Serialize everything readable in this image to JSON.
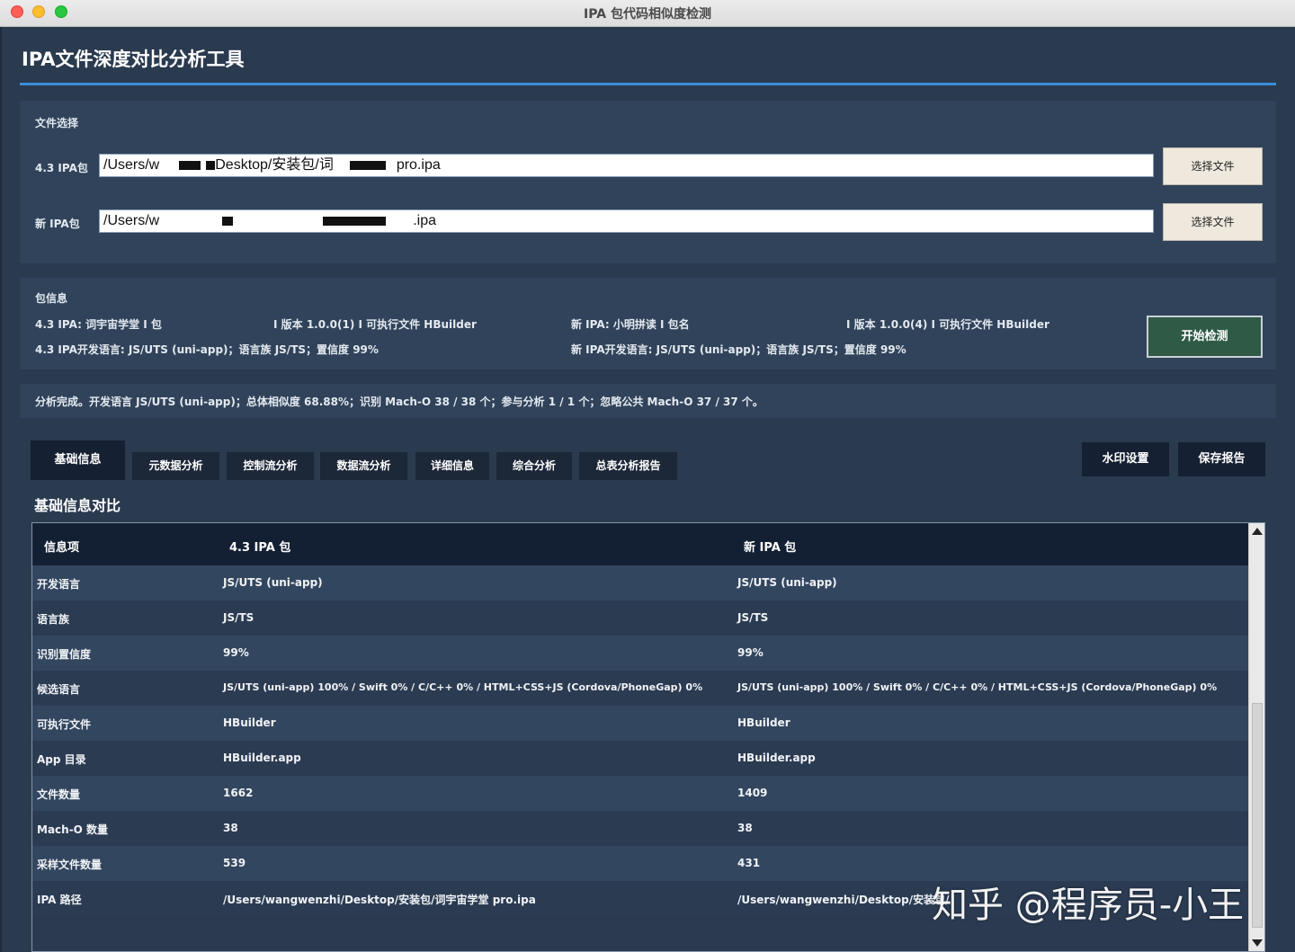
{
  "window": {
    "title": "IPA 包代码相似度检测"
  },
  "app": {
    "title": "IPA文件深度对比分析工具"
  },
  "file_select": {
    "section_label": "文件选择",
    "old": {
      "label": "4.3 IPA包",
      "path_prefix": "/Users/w",
      "path_mid": "Desktop/安装包/词",
      "path_suffix": "pro.ipa",
      "button": "选择文件"
    },
    "new": {
      "label": "新 IPA包",
      "path_prefix": "/Users/w",
      "path_mid": "",
      "path_suffix": ".ipa",
      "button": "选择文件"
    }
  },
  "package_info": {
    "section_label": "包信息",
    "old_line1_a": "4.3 IPA: 词宇宙学堂 I 包",
    "old_line1_b": "I 版本 1.0.0(1) I 可执行文件 HBuilder",
    "old_line2": "4.3 IPA开发语言: JS/UTS (uni-app)；语言族 JS/TS；置信度 99%",
    "new_line1_a": "新 IPA: 小明拼读 I 包名",
    "new_line1_b": "I 版本 1.0.0(4) I 可执行文件 HBuilder",
    "new_line2": "新 IPA开发语言: JS/UTS (uni-app)；语言族 JS/TS；置信度 99%",
    "start_button": "开始检测"
  },
  "status": {
    "text": "分析完成。开发语言 JS/UTS (uni-app)；总体相似度 68.88%；识别 Mach-O 38 / 38 个；参与分析 1 / 1 个；忽略公共 Mach-O 37 / 37 个。"
  },
  "tabs": [
    {
      "label": "基础信息"
    },
    {
      "label": "元数据分析"
    },
    {
      "label": "控制流分析"
    },
    {
      "label": "数据流分析"
    },
    {
      "label": "详细信息"
    },
    {
      "label": "综合分析"
    },
    {
      "label": "总表分析报告"
    }
  ],
  "actions": {
    "watermark": "水印设置",
    "save": "保存报告"
  },
  "table": {
    "heading": "基础信息对比",
    "columns": [
      "信息项",
      "4.3 IPA 包",
      "新 IPA 包"
    ],
    "rows": [
      [
        "开发语言",
        "JS/UTS (uni-app)",
        "JS/UTS (uni-app)"
      ],
      [
        "语言族",
        "JS/TS",
        "JS/TS"
      ],
      [
        "识别置信度",
        "99%",
        "99%"
      ],
      [
        "候选语言",
        "JS/UTS (uni-app) 100% / Swift 0% / C/C++ 0% / HTML+CSS+JS (Cordova/PhoneGap) 0%",
        "JS/UTS (uni-app) 100% / Swift 0% / C/C++ 0% / HTML+CSS+JS (Cordova/PhoneGap) 0%"
      ],
      [
        "可执行文件",
        "HBuilder",
        "HBuilder"
      ],
      [
        "App 目录",
        "HBuilder.app",
        "HBuilder.app"
      ],
      [
        "文件数量",
        "1662",
        "1409"
      ],
      [
        "Mach-O 数量",
        "38",
        "38"
      ],
      [
        "采样文件数量",
        "539",
        "431"
      ],
      [
        "IPA 路径",
        "/Users/wangwenzhi/Desktop/安装包/词宇宙学堂 pro.ipa",
        "/Users/wangwenzhi/Desktop/安装包/"
      ]
    ]
  },
  "watermark_overlay": "知乎 @程序员-小王"
}
